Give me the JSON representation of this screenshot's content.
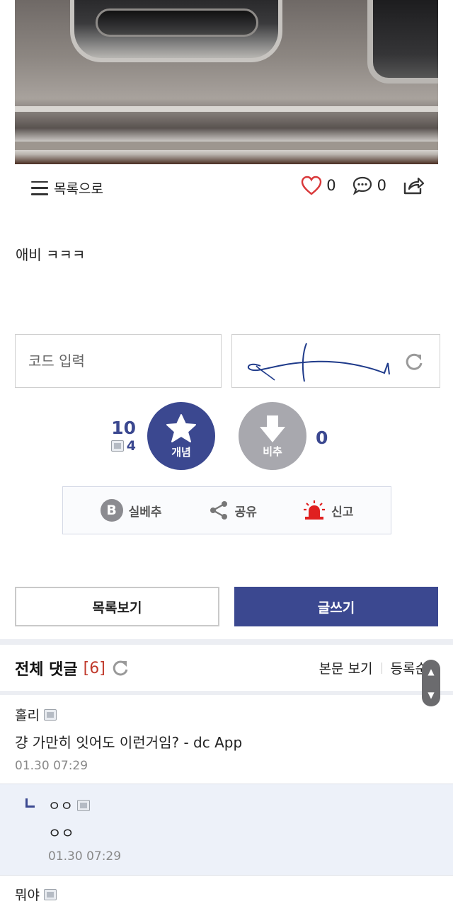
{
  "toolbar": {
    "list_label": "목록으로",
    "like_count": "0",
    "comment_count": "0"
  },
  "post": {
    "text": "애비 ㅋㅋㅋ"
  },
  "captcha": {
    "placeholder": "코드 입력"
  },
  "vote": {
    "up_total": "10",
    "up_fixed": "4",
    "up_label": "개념",
    "down_label": "비추",
    "down_count": "0"
  },
  "share_bar": {
    "best_label": "실베추",
    "best_badge": "B",
    "share_label": "공유",
    "report_label": "신고"
  },
  "buttons": {
    "list_view": "목록보기",
    "write": "글쓰기"
  },
  "comments_header": {
    "title": "전체 댓글",
    "count": "[6]",
    "view_body": "본문 보기",
    "sort": "등록순"
  },
  "comments": [
    {
      "nick": "홀리",
      "text": "걍 가만히 잇어도 이런거임? - dc App",
      "date": "01.30 07:29"
    },
    {
      "nick": "ㅇㅇ",
      "text": "ㅇㅇ",
      "date": "01.30 07:29"
    },
    {
      "nick": "뭐야"
    }
  ],
  "colors": {
    "accent": "#3b4890",
    "downvote": "#a8a8ae",
    "comment_count": "#c0392b",
    "reply_bg": "#edf1f9"
  }
}
